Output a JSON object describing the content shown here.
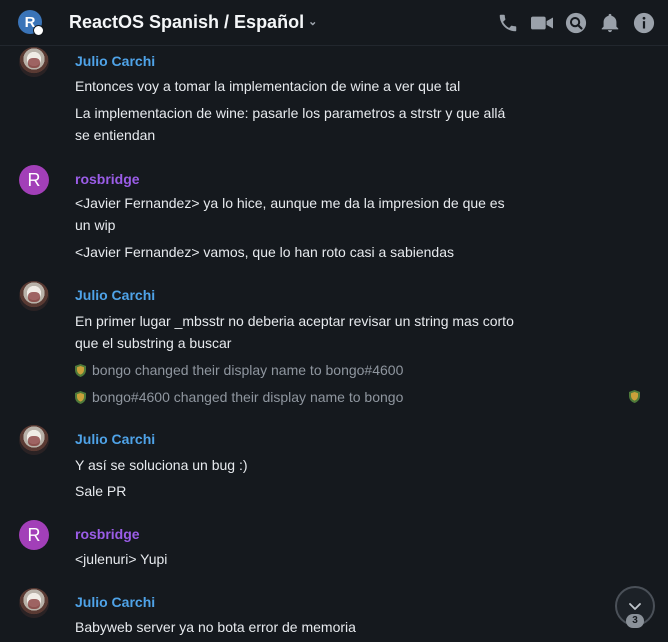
{
  "header": {
    "room_initial": "R",
    "room_name": "ReactOS Spanish / Español",
    "caret": "⌄"
  },
  "messages": [
    {
      "sender": "Julio Carchi",
      "avatar": "photo",
      "lines": [
        "Entonces voy a tomar la implementacion de wine a ver que tal",
        "La implementacion de wine: pasarle los parametros a strstr y que allá se entiendan"
      ]
    },
    {
      "sender": "rosbridge",
      "avatar": "R",
      "lines": [
        "<Javier Fernandez> ya lo hice, aunque me da la impresion de que es un wip",
        "<Javier Fernandez> vamos, que lo han roto casi a sabiendas"
      ]
    },
    {
      "sender": "Julio Carchi",
      "avatar": "photo",
      "lines": [
        "En primer lugar _mbsstr no deberia aceptar revisar un string mas corto que el substring a buscar"
      ]
    },
    {
      "sender": "Julio Carchi",
      "avatar": "photo",
      "lines": [
        "Y así se soluciona un bug :)",
        "Sale PR"
      ]
    },
    {
      "sender": "rosbridge",
      "avatar": "R",
      "lines": [
        "<julenuri> Yupi"
      ]
    },
    {
      "sender": "Julio Carchi",
      "avatar": "photo",
      "lines": [
        "Babyweb server ya no bota error de memoria"
      ]
    }
  ],
  "events": [
    "bongo changed their display name to bongo#4600",
    "bongo#4600 changed their display name to bongo"
  ],
  "jump_to_bottom": {
    "unread_count": "3"
  },
  "icons": [
    "phone-icon",
    "video-icon",
    "search-icon",
    "bell-icon",
    "info-icon",
    "shield-icon",
    "chevron-down-icon"
  ],
  "colors": {
    "background": "#15191e",
    "sender_julio": "#4fa3e8",
    "sender_ros": "#9b5de8",
    "avatar_r": "#a23fb8",
    "room_avatar": "#3a74b8"
  }
}
